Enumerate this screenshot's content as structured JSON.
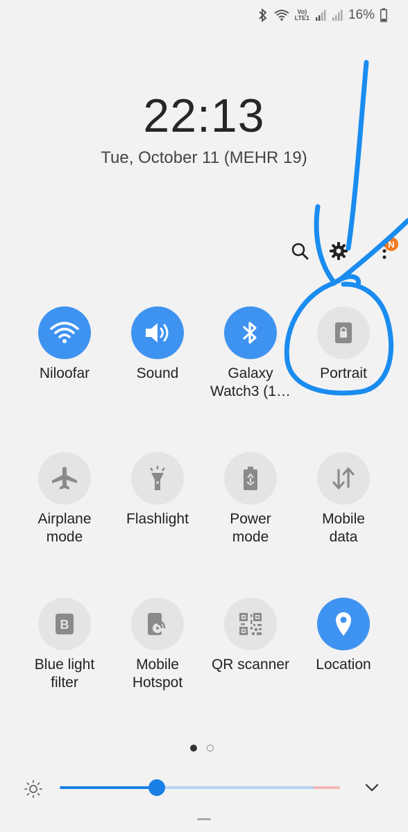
{
  "status_bar": {
    "battery": "16%",
    "icons": [
      "bluetooth-icon",
      "wifi-icon",
      "volte-icon",
      "signal-icon",
      "signal-icon",
      "battery-icon"
    ],
    "volte_line1": "Vo)",
    "volte_line2": "LTE1"
  },
  "clock": {
    "time": "22:13",
    "date": "Tue, October 11 (MEHR 19)"
  },
  "top_actions": {
    "notification_badge": "N"
  },
  "colors": {
    "accent": "#3e93f0",
    "tile_off": "#e4e4e4",
    "annotation": "#1a8cf0",
    "badge": "#f47a20"
  },
  "tiles": [
    {
      "label": "Niloofar",
      "icon": "wifi-icon",
      "on": true
    },
    {
      "label": "Sound",
      "icon": "sound-icon",
      "on": true
    },
    {
      "label": "Galaxy\nWatch3 (1…",
      "icon": "bluetooth-icon",
      "on": true
    },
    {
      "label": "Portrait",
      "icon": "rotation-lock-icon",
      "on": false
    },
    {
      "label": "Airplane\nmode",
      "icon": "airplane-icon",
      "on": false
    },
    {
      "label": "Flashlight",
      "icon": "flashlight-icon",
      "on": false
    },
    {
      "label": "Power\nmode",
      "icon": "power-mode-icon",
      "on": false
    },
    {
      "label": "Mobile\ndata",
      "icon": "mobile-data-icon",
      "on": false
    },
    {
      "label": "Blue light\nfilter",
      "icon": "blue-light-icon",
      "on": false
    },
    {
      "label": "Mobile\nHotspot",
      "icon": "hotspot-icon",
      "on": false
    },
    {
      "label": "QR scanner",
      "icon": "qr-icon",
      "on": false
    },
    {
      "label": "Location",
      "icon": "location-icon",
      "on": true
    }
  ],
  "pager": {
    "current": 1,
    "total": 2
  },
  "brightness": {
    "level": 0.35
  }
}
